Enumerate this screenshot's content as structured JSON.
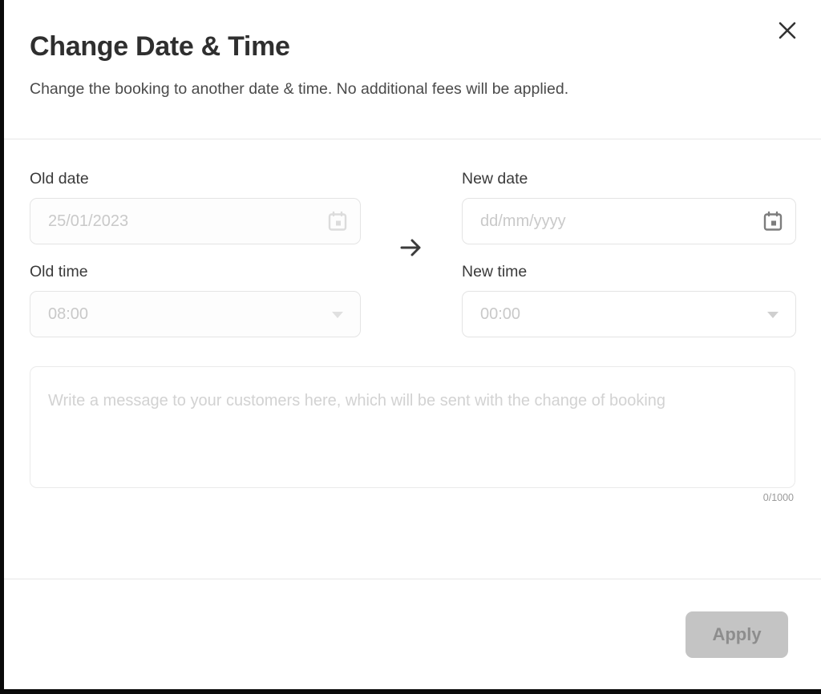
{
  "dialog": {
    "title": "Change Date & Time",
    "subtitle": "Change the booking to another date & time. No additional fees will be applied.",
    "close_icon": "close-icon",
    "transition_icon": "arrow-right-icon"
  },
  "fields": {
    "old_date": {
      "label": "Old date",
      "value": "25/01/2023",
      "icon": "calendar-icon",
      "disabled": true
    },
    "new_date": {
      "label": "New date",
      "placeholder": "dd/mm/yyyy",
      "icon": "calendar-icon",
      "disabled": false
    },
    "old_time": {
      "label": "Old time",
      "value": "08:00",
      "icon": "chevron-down-icon",
      "disabled": true
    },
    "new_time": {
      "label": "New time",
      "value": "00:00",
      "icon": "chevron-down-icon",
      "disabled": false
    }
  },
  "message": {
    "placeholder": "Write a message to your customers here, which will be sent with the change of booking",
    "counter": "0/1000",
    "max_length": 1000
  },
  "footer": {
    "apply_label": "Apply",
    "apply_disabled": true
  },
  "colors": {
    "title": "#2f2f2f",
    "subtitle": "#4a4a4a",
    "label": "#3a3a3a",
    "placeholder": "#c9c9c9",
    "border": "#e4e4e4",
    "divider": "#e6e6e6",
    "button_disabled_bg": "#c4c4c4",
    "button_disabled_text": "#8d8d8d",
    "icon_disabled": "#dcdcdc",
    "icon_active": "#7d7d7d"
  }
}
